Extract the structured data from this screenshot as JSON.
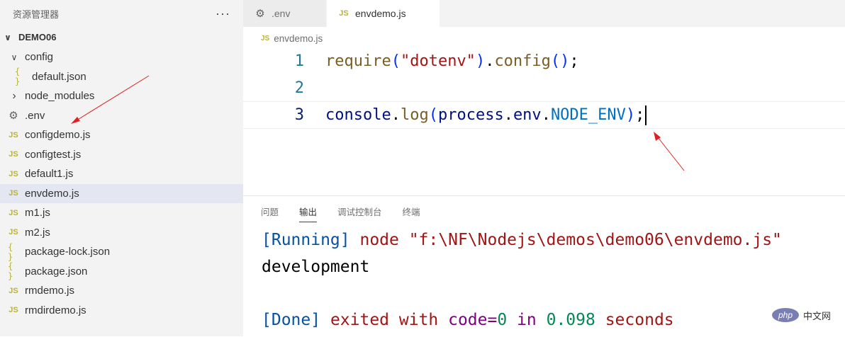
{
  "sidebar": {
    "title": "资源管理器",
    "more": "···",
    "folder": "DEMO06",
    "items": [
      {
        "label": "config",
        "type": "folder-open",
        "indent": 0
      },
      {
        "label": "default.json",
        "type": "json",
        "indent": 1
      },
      {
        "label": "node_modules",
        "type": "folder-closed",
        "indent": 0
      },
      {
        "label": ".env",
        "type": "gear",
        "indent": 0
      },
      {
        "label": "configdemo.js",
        "type": "js",
        "indent": 0
      },
      {
        "label": "configtest.js",
        "type": "js",
        "indent": 0
      },
      {
        "label": "default1.js",
        "type": "js",
        "indent": 0
      },
      {
        "label": "envdemo.js",
        "type": "js",
        "indent": 0,
        "selected": true
      },
      {
        "label": "m1.js",
        "type": "js",
        "indent": 0
      },
      {
        "label": "m2.js",
        "type": "js",
        "indent": 0
      },
      {
        "label": "package-lock.json",
        "type": "json",
        "indent": 0
      },
      {
        "label": "package.json",
        "type": "json",
        "indent": 0
      },
      {
        "label": "rmdemo.js",
        "type": "js",
        "indent": 0
      },
      {
        "label": "rmdirdemo.js",
        "type": "js",
        "indent": 0
      }
    ]
  },
  "tabs": [
    {
      "label": ".env",
      "icon": "gear-icon",
      "active": false
    },
    {
      "label": "envdemo.js",
      "icon": "js-file-icon",
      "active": true
    }
  ],
  "breadcrumb": {
    "file": "envdemo.js",
    "icon_text": "JS"
  },
  "editor": {
    "line_numbers": [
      "1",
      "2",
      "3"
    ],
    "line1": {
      "fn": "require",
      "p1": "(",
      "str": "\"dotenv\"",
      "p1c": ")",
      "dot": ".",
      "fn2": "config",
      "p2": "()",
      "semi": ";"
    },
    "line3": {
      "obj": "console",
      "dot": ".",
      "fn": "log",
      "p1": "(",
      "var1": "process",
      "dot2": ".",
      "var2": "env",
      "dot3": ".",
      "const": "NODE_ENV",
      "p1c": ")",
      "semi": ";"
    }
  },
  "panel": {
    "tabs": [
      "问题",
      "输出",
      "调试控制台",
      "终端"
    ],
    "active_tab": "输出",
    "output": {
      "run_tag": "[Running]",
      "run_cmd": " node \"f:\\NF\\Nodejs\\demos\\demo06\\envdemo.js\"",
      "result": "development",
      "done_tag": "[Done]",
      "done_1": " exited with ",
      "done_code_label": "code=",
      "done_code": "0",
      "done_2": " in ",
      "done_time": "0.098",
      "done_3": " seconds"
    }
  },
  "watermark": {
    "logo": "php",
    "text": "中文网"
  },
  "icon_text": {
    "js": "JS",
    "json": "{ }",
    "gear": "⚙",
    "chevron_down": "∨",
    "chevron_right": "›"
  },
  "colors": {
    "annotation_arrow": "#e02020",
    "selection": "#e4e6f1"
  }
}
